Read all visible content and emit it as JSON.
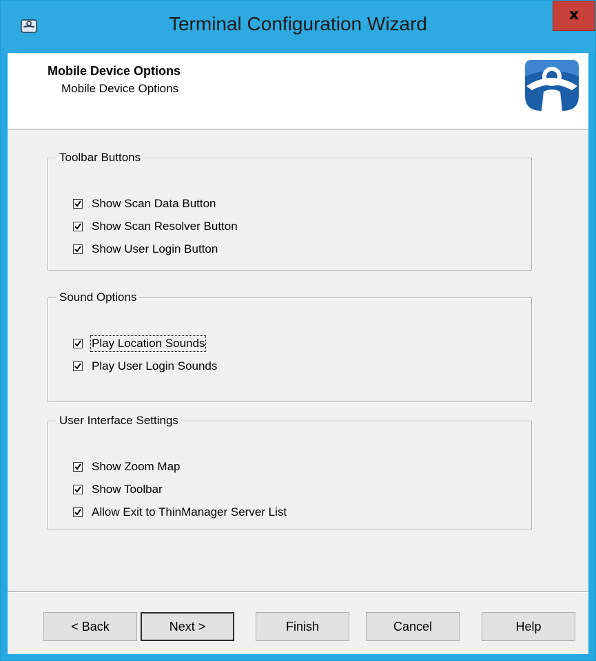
{
  "window": {
    "title": "Terminal Configuration Wizard",
    "close_glyph": "x",
    "title_icon": "wizard-app-icon"
  },
  "header": {
    "title": "Mobile Device Options",
    "subtitle": "Mobile Device Options",
    "logo": "thinmanager-logo"
  },
  "groups": {
    "toolbar": {
      "legend": "Toolbar Buttons",
      "items": [
        {
          "label": "Show Scan Data Button",
          "checked": true
        },
        {
          "label": "Show Scan Resolver Button",
          "checked": true
        },
        {
          "label": "Show User Login Button",
          "checked": true
        }
      ]
    },
    "sound": {
      "legend": "Sound Options",
      "items": [
        {
          "label": "Play Location Sounds",
          "checked": true,
          "focused": true
        },
        {
          "label": "Play User Login Sounds",
          "checked": true
        }
      ]
    },
    "ui": {
      "legend": "User Interface Settings",
      "items": [
        {
          "label": "Show Zoom Map",
          "checked": true
        },
        {
          "label": "Show Toolbar",
          "checked": true
        },
        {
          "label": "Allow Exit to ThinManager Server List",
          "checked": true
        }
      ]
    }
  },
  "buttons": {
    "back": "< Back",
    "next": "Next >",
    "finish": "Finish",
    "cancel": "Cancel",
    "help": "Help"
  },
  "colors": {
    "title_bar": "#2eaae1",
    "close_button": "#c7413a",
    "dialog_background": "#f0f0f0",
    "logo_blue": "#1c5fa8"
  }
}
